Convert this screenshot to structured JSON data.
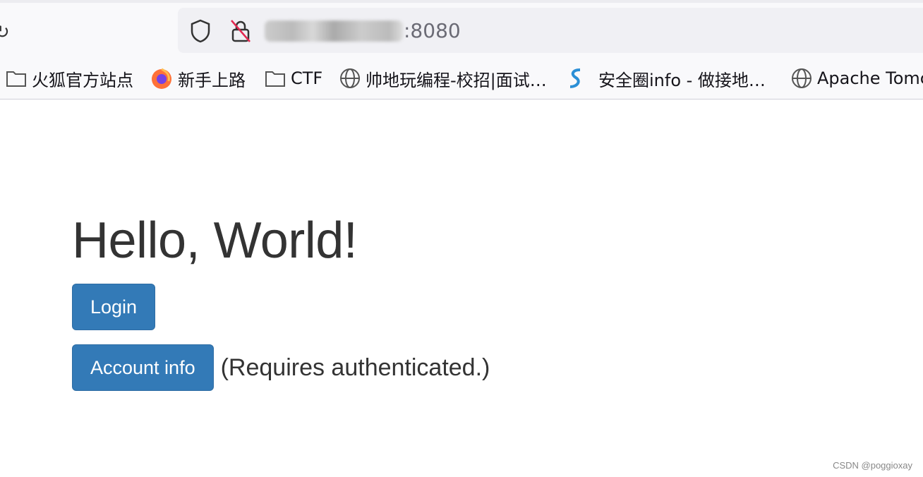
{
  "browser": {
    "url_visible": ":8080",
    "bookmarks": [
      {
        "label": "火狐官方站点",
        "icon": "folder-icon"
      },
      {
        "label": "新手上路",
        "icon": "firefox-icon"
      },
      {
        "label": "CTF",
        "icon": "folder-icon"
      },
      {
        "label": "帅地玩编程-校招|面试…",
        "icon": "globe-icon"
      },
      {
        "label": "安全圈info - 做接地…",
        "icon": "s-logo-icon"
      },
      {
        "label": "Apache Tomc",
        "icon": "globe-icon"
      }
    ]
  },
  "page": {
    "heading": "Hello, World!",
    "login_label": "Login",
    "account_label": "Account info",
    "account_note": "(Requires authenticated.)",
    "accent": "#337ab7"
  },
  "watermark": "CSDN @poggioxay"
}
